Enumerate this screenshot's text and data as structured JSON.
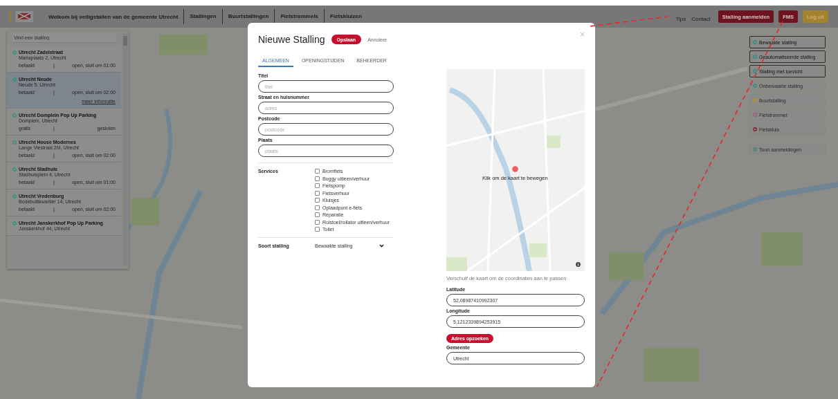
{
  "header": {
    "title": "Welkom bij veiligstallen van de gemeente Utrecht",
    "nav": [
      "Stallingen",
      "Buurtstallingen",
      "Fietstrommels",
      "Fietskluizen"
    ],
    "links": [
      "Tips",
      "Contact"
    ],
    "buttons": [
      {
        "label": "Stalling aanmelden",
        "kind": "primary"
      },
      {
        "label": "FMS",
        "kind": "primary"
      },
      {
        "label": "Log uit",
        "kind": "warning"
      }
    ]
  },
  "sidebar": {
    "search": {
      "placeholder": "Vind een stalling"
    },
    "items": [
      {
        "title": "Utrecht Zadelstraat",
        "address": "Mariaplaats 2, Utrecht",
        "price": "betaald",
        "separator": "|",
        "status": "open, sluit om 01:00",
        "selected": false
      },
      {
        "title": "Utrecht Neude",
        "address": "Neude 5, Utrecht",
        "price": "betaald",
        "separator": "|",
        "status": "open, sluit om 02:00",
        "selected": true,
        "link": "meer informatie"
      },
      {
        "title": "Utrecht Domplein Pop Up Parking",
        "address": "Domplein, Utrecht",
        "price": "gratis",
        "separator": "|",
        "status": "gesloten",
        "selected": false
      },
      {
        "title": "Utrecht House Modernes",
        "address": "Lange Viestraat 2M, Utrecht",
        "price": "betaald",
        "separator": "|",
        "status": "open, sluit om 02:00",
        "selected": false
      },
      {
        "title": "Utrecht Stadhuis",
        "address": "Stadhuisplein 4, Utrecht",
        "price": "betaald",
        "separator": "|",
        "status": "open, sluit om 01:00",
        "selected": false
      },
      {
        "title": "Utrecht Vredenburg",
        "address": "Bodebuiltkwartier 14, Utrecht",
        "price": "betaald",
        "separator": "|",
        "status": "open, sluit om 02:00",
        "selected": false
      },
      {
        "title": "Utrecht Janskerkhof Pop Up Parking",
        "address": "Janskerkhof 44, Utrecht",
        "selected": false
      }
    ]
  },
  "legend": [
    {
      "label": "Bewaakte stalling",
      "color": "#2f8f80",
      "selected": true
    },
    {
      "label": "Geautomatiseerde stalling",
      "color": "#2f8f80",
      "selected": true
    },
    {
      "label": "Stalling met toezicht",
      "color": "#2f8f80",
      "selected": true
    },
    {
      "label": "Onbewaakte stalling",
      "color": "#2f8f80",
      "selected": false
    },
    {
      "label": "Buurtstalling",
      "color": "#b59a2a",
      "selected": false
    },
    {
      "label": "Fietstrommel",
      "color": "#b0508a",
      "selected": false
    },
    {
      "label": "Fietskluis",
      "color": "#8a1530",
      "selected": false
    },
    {
      "label": "Toon aanmeldingen",
      "color": "#2f8f80",
      "selected": false
    }
  ],
  "modal": {
    "title": "Nieuwe Stalling",
    "save": "Opslaan",
    "cancel": "Annuleer",
    "close": "×",
    "tabs": [
      {
        "label": "ALGEMEEN",
        "selected": true
      },
      {
        "label": "OPENINGSTIJDEN",
        "selected": false
      },
      {
        "label": "BEHEERDER",
        "selected": false
      }
    ],
    "fields": [
      {
        "label": "Titel",
        "placeholder": "titel"
      },
      {
        "label": "Straat en huisnummer",
        "placeholder": "adres"
      },
      {
        "label": "Postcode",
        "placeholder": "postcode"
      },
      {
        "label": "Plaats",
        "placeholder": "plaats"
      }
    ],
    "services": {
      "label": "Services",
      "options": [
        {
          "label": "Bromfiets",
          "checked": false
        },
        {
          "label": "Buggy uitleen/verhuur",
          "checked": false
        },
        {
          "label": "Fietspomp",
          "checked": false
        },
        {
          "label": "Fietsverhuur",
          "checked": false
        },
        {
          "label": "Kluisjes",
          "checked": false
        },
        {
          "label": "Oplaadpunt e-fiets",
          "checked": false
        },
        {
          "label": "Reparatie",
          "checked": false
        },
        {
          "label": "Rolstoel/rollator uitleen/verhuur",
          "checked": false
        },
        {
          "label": "Toilet",
          "checked": false
        }
      ]
    },
    "type": {
      "label": "Soort stalling",
      "value": "Bewaakte stalling"
    },
    "map": {
      "overlay": "Klik om de kaart te bewegen",
      "hint": "Verschuif de kaart om de coordinaten aan te passen"
    },
    "coords": [
      {
        "label": "Latitude",
        "value": "52,08987410992307"
      },
      {
        "label": "Longitude",
        "value": "5,1212339894253915"
      }
    ],
    "lookup": "Adres opzoeken",
    "municipality": {
      "label": "Gemeente",
      "value": "Utrecht"
    }
  }
}
